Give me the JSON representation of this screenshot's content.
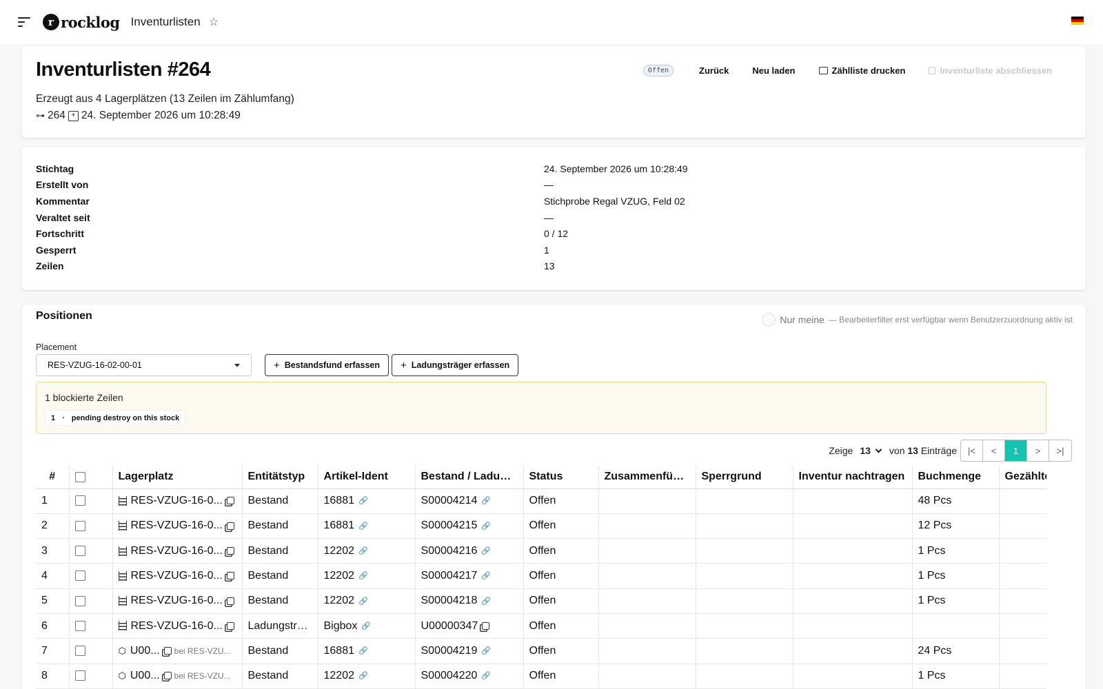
{
  "topbar": {
    "logo_mark": "r",
    "logo_text": "rocklog",
    "app_title": "Inventurlisten",
    "flag_colors": [
      "#000000",
      "#dd0000",
      "#ffce00"
    ]
  },
  "header": {
    "title": "Inventurlisten #264",
    "subtitle": "Erzeugt aus 4 Lagerplätzen (13 Zeilen im Zählumfang)",
    "id": "264",
    "created": "24. September 2026 um 10:28:49",
    "status_badge": "Offen",
    "actions": {
      "back": "Zurück",
      "reload": "Neu laden",
      "print": "Zählliste drucken",
      "close": "Inventurliste abschliessen"
    }
  },
  "info": [
    {
      "key": "Stichtag",
      "value": "24. September 2026 um 10:28:49"
    },
    {
      "key": "Erstellt von",
      "value": "—"
    },
    {
      "key": "Kommentar",
      "value": "Stichprobe Regal VZUG, Feld 02"
    },
    {
      "key": "Veraltet seit",
      "value": "—"
    },
    {
      "key": "Fortschritt",
      "value": "0 / 12"
    },
    {
      "key": "Gesperrt",
      "value": "1"
    },
    {
      "key": "Zeilen",
      "value": "13"
    }
  ],
  "positions": {
    "title": "Positionen",
    "toggle_label": "Nur meine",
    "toggle_hint": "— Bearbeiterfilter erst verfügbar wenn Benutzerzuordnung aktiv ist",
    "placement_label": "Placement",
    "placement_value": "RES-VZUG-16-02-00-01",
    "btn_stock": "Bestandsfund erfassen",
    "btn_carrier": "Ladungsträger erfassen",
    "blocked_title": "1 blockierte Zeilen",
    "blocked_count": "1",
    "blocked_sep": "·",
    "blocked_reason": "pending destroy on this stock",
    "pager": {
      "show": "Zeige",
      "per_page": "13",
      "of": "von",
      "total": "13",
      "entries": "Einträge",
      "first": "|<",
      "prev": "<",
      "page": "1",
      "next": ">",
      "last": ">|"
    },
    "columns": [
      "#",
      "",
      "Lagerplatz",
      "Entitätstyp",
      "Artikel-Ident",
      "Bestand / Ladungsträger",
      "Status",
      "Zusammenführung",
      "Sperrgrund",
      "Inventur nachtragen",
      "Buchmenge",
      "Gezählte Menge"
    ],
    "rows": [
      {
        "n": "1",
        "loc": "RES-VZUG-16-0...",
        "type": "Bestand",
        "art": "16881",
        "stock": "S00004214",
        "status": "Offen",
        "qty": "48 Pcs"
      },
      {
        "n": "2",
        "loc": "RES-VZUG-16-0...",
        "type": "Bestand",
        "art": "16881",
        "stock": "S00004215",
        "status": "Offen",
        "qty": "12 Pcs"
      },
      {
        "n": "3",
        "loc": "RES-VZUG-16-0...",
        "type": "Bestand",
        "art": "12202",
        "stock": "S00004216",
        "status": "Offen",
        "qty": "1 Pcs"
      },
      {
        "n": "4",
        "loc": "RES-VZUG-16-0...",
        "type": "Bestand",
        "art": "12202",
        "stock": "S00004217",
        "status": "Offen",
        "qty": "1 Pcs"
      },
      {
        "n": "5",
        "loc": "RES-VZUG-16-0...",
        "type": "Bestand",
        "art": "12202",
        "stock": "S00004218",
        "status": "Offen",
        "qty": "1 Pcs"
      },
      {
        "n": "6",
        "loc": "RES-VZUG-16-0...",
        "type": "Ladungsträ...",
        "art": "Bigbox",
        "stock": "U00000347",
        "status": "Offen",
        "qty": ""
      },
      {
        "n": "7",
        "loc": "U00...",
        "sub": "bei RES-VZU...",
        "type": "Bestand",
        "art": "16881",
        "stock": "S00004219",
        "status": "Offen",
        "qty": "24 Pcs"
      },
      {
        "n": "8",
        "loc": "U00...",
        "sub": "bei RES-VZU...",
        "type": "Bestand",
        "art": "12202",
        "stock": "S00004220",
        "status": "Offen",
        "qty": "1 Pcs"
      }
    ]
  }
}
